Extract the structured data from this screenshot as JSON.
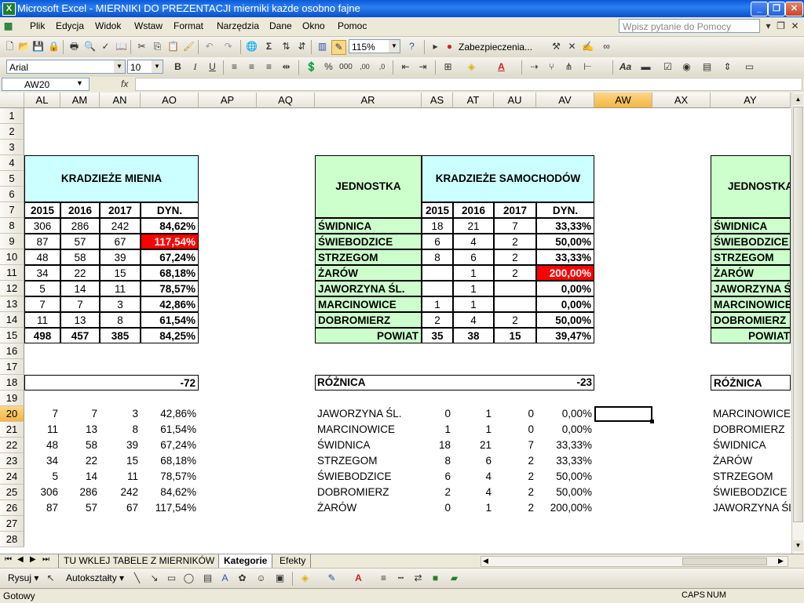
{
  "window": {
    "title": "Microsoft Excel - MIERNIKI DO PREZENTACJI mierniki każde osobno fajne",
    "app_icon": "X"
  },
  "menu": {
    "items": [
      "Plik",
      "Edycja",
      "Widok",
      "Wstaw",
      "Format",
      "Narzędzia",
      "Dane",
      "Okno",
      "Pomoc"
    ],
    "ask_placeholder": "Wpisz pytanie do Pomocy"
  },
  "toolbar_standard": {
    "zoom": "115%",
    "security_label": "Zabezpieczenia..."
  },
  "toolbar_format": {
    "font": "Arial",
    "size": "10"
  },
  "formula": {
    "name_box": "AW20",
    "fx": "fx",
    "value": ""
  },
  "columns": [
    "AL",
    "AM",
    "AN",
    "AO",
    "AP",
    "AQ",
    "AR",
    "AS",
    "AT",
    "AU",
    "AV",
    "AW",
    "AX",
    "AY"
  ],
  "selected_column": "AW",
  "rows": [
    "1",
    "2",
    "3",
    "4",
    "5",
    "6",
    "7",
    "8",
    "9",
    "10",
    "11",
    "12",
    "13",
    "14",
    "15",
    "16",
    "17",
    "18",
    "19",
    "20",
    "21",
    "22",
    "23",
    "24",
    "25",
    "26",
    "27",
    "28"
  ],
  "selected_row": "20",
  "table1": {
    "title": "KRADZIEŻE MIENIA",
    "headers": [
      "2015",
      "2016",
      "2017",
      "DYN."
    ],
    "rows": [
      [
        "306",
        "286",
        "242",
        "84,62%"
      ],
      [
        "87",
        "57",
        "67",
        "117,54%"
      ],
      [
        "48",
        "58",
        "39",
        "67,24%"
      ],
      [
        "34",
        "22",
        "15",
        "68,18%"
      ],
      [
        "5",
        "14",
        "11",
        "78,57%"
      ],
      [
        "7",
        "7",
        "3",
        "42,86%"
      ],
      [
        "11",
        "13",
        "8",
        "61,54%"
      ]
    ],
    "total": [
      "498",
      "457",
      "385",
      "84,25%"
    ],
    "diff": "-72"
  },
  "table2": {
    "unit_header": "JEDNOSTKA",
    "title": "KRADZIEŻE SAMOCHODÓW",
    "headers": [
      "2015",
      "2016",
      "2017",
      "DYN."
    ],
    "rows": [
      [
        "ŚWIDNICA",
        "18",
        "21",
        "7",
        "33,33%"
      ],
      [
        "ŚWIEBODZICE",
        "6",
        "4",
        "2",
        "50,00%"
      ],
      [
        "STRZEGOM",
        "8",
        "6",
        "2",
        "33,33%"
      ],
      [
        "ŻARÓW",
        "",
        "1",
        "2",
        "200,00%"
      ],
      [
        "JAWORZYNA ŚL.",
        "",
        "1",
        "",
        "0,00%"
      ],
      [
        "MARCINOWICE",
        "1",
        "1",
        "",
        "0,00%"
      ],
      [
        "DOBROMIERZ",
        "2",
        "4",
        "2",
        "50,00%"
      ]
    ],
    "total": [
      "POWIAT",
      "35",
      "38",
      "15",
      "39,47%"
    ],
    "diff_label": "RÓŻNICA",
    "diff": "-23"
  },
  "table3": {
    "unit_header": "JEDNOSTKA",
    "rows": [
      "ŚWIDNICA",
      "ŚWIEBODZICE",
      "STRZEGOM",
      "ŻARÓW",
      "JAWORZYNA ŚL.",
      "MARCINOWICE",
      "DOBROMIERZ"
    ],
    "total": "POWIAT",
    "diff_label": "RÓŻNICA"
  },
  "sorted1": [
    [
      "7",
      "7",
      "3",
      "42,86%"
    ],
    [
      "11",
      "13",
      "8",
      "61,54%"
    ],
    [
      "48",
      "58",
      "39",
      "67,24%"
    ],
    [
      "34",
      "22",
      "15",
      "68,18%"
    ],
    [
      "5",
      "14",
      "11",
      "78,57%"
    ],
    [
      "306",
      "286",
      "242",
      "84,62%"
    ],
    [
      "87",
      "57",
      "67",
      "117,54%"
    ]
  ],
  "sorted2": [
    [
      "JAWORZYNA ŚL.",
      "0",
      "1",
      "0",
      "0,00%"
    ],
    [
      "MARCINOWICE",
      "1",
      "1",
      "0",
      "0,00%"
    ],
    [
      "ŚWIDNICA",
      "18",
      "21",
      "7",
      "33,33%"
    ],
    [
      "STRZEGOM",
      "8",
      "6",
      "2",
      "33,33%"
    ],
    [
      "ŚWIEBODZICE",
      "6",
      "4",
      "2",
      "50,00%"
    ],
    [
      "DOBROMIERZ",
      "2",
      "4",
      "2",
      "50,00%"
    ],
    [
      "ŻARÓW",
      "0",
      "1",
      "2",
      "200,00%"
    ]
  ],
  "sorted3": [
    "MARCINOWICE",
    "DOBROMIERZ",
    "ŚWIDNICA",
    "ŻARÓW",
    "STRZEGOM",
    "ŚWIEBODZICE",
    "JAWORZYNA ŚL."
  ],
  "sheet_tabs": [
    "TU WKLEJ TABELE Z MIERNIKÓW",
    "Kategorie",
    "Efekty"
  ],
  "active_tab": "Kategorie",
  "draw_toolbar": {
    "draw_label": "Rysuj",
    "autoshapes_label": "Autokształty"
  },
  "status": {
    "ready": "Gotowy",
    "caps": "CAPS",
    "num": "NUM"
  },
  "colors": {
    "header_fill": "#ccffff",
    "unit_fill": "#ccffcc",
    "alert_fill": "#ff0000",
    "title_bar": "#0a58d8"
  }
}
